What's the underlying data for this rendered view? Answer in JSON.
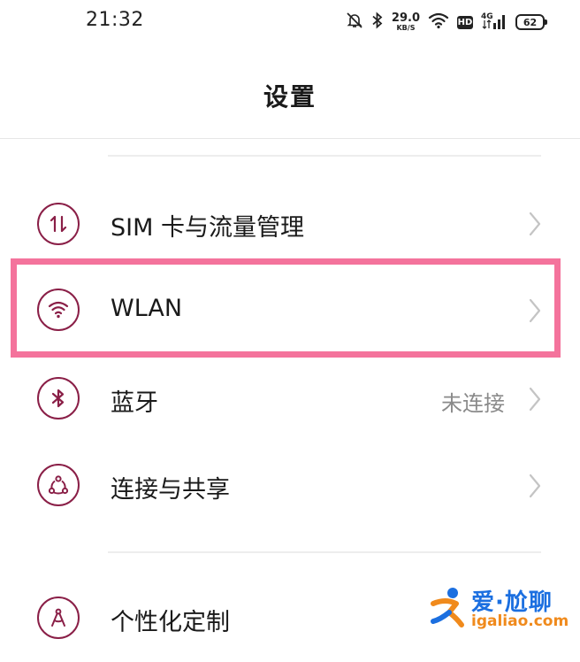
{
  "status_bar": {
    "time": "21:32",
    "net_speed_value": "29.0",
    "net_speed_unit": "KB/S",
    "hd_label": "HD",
    "network_type": "4G",
    "battery": "62"
  },
  "page": {
    "title": "设置"
  },
  "menu": [
    {
      "label": "SIM 卡与流量管理",
      "icon": "sim-data-icon",
      "value": ""
    },
    {
      "label": "WLAN",
      "icon": "wifi-icon",
      "value": ""
    },
    {
      "label": "蓝牙",
      "icon": "bluetooth-icon",
      "value": "未连接"
    },
    {
      "label": "连接与共享",
      "icon": "connection-share-icon",
      "value": ""
    },
    {
      "label": "个性化定制",
      "icon": "personalization-icon",
      "value": ""
    }
  ],
  "highlighted_item": "WLAN",
  "colors": {
    "icon_accent": "#8a1f47",
    "highlight_border": "#f4739c",
    "chevron": "#c4c4c4",
    "secondary_text": "#8a8a8a"
  },
  "watermark": {
    "name": "爱·尬聊",
    "url": "igaliao.com"
  }
}
